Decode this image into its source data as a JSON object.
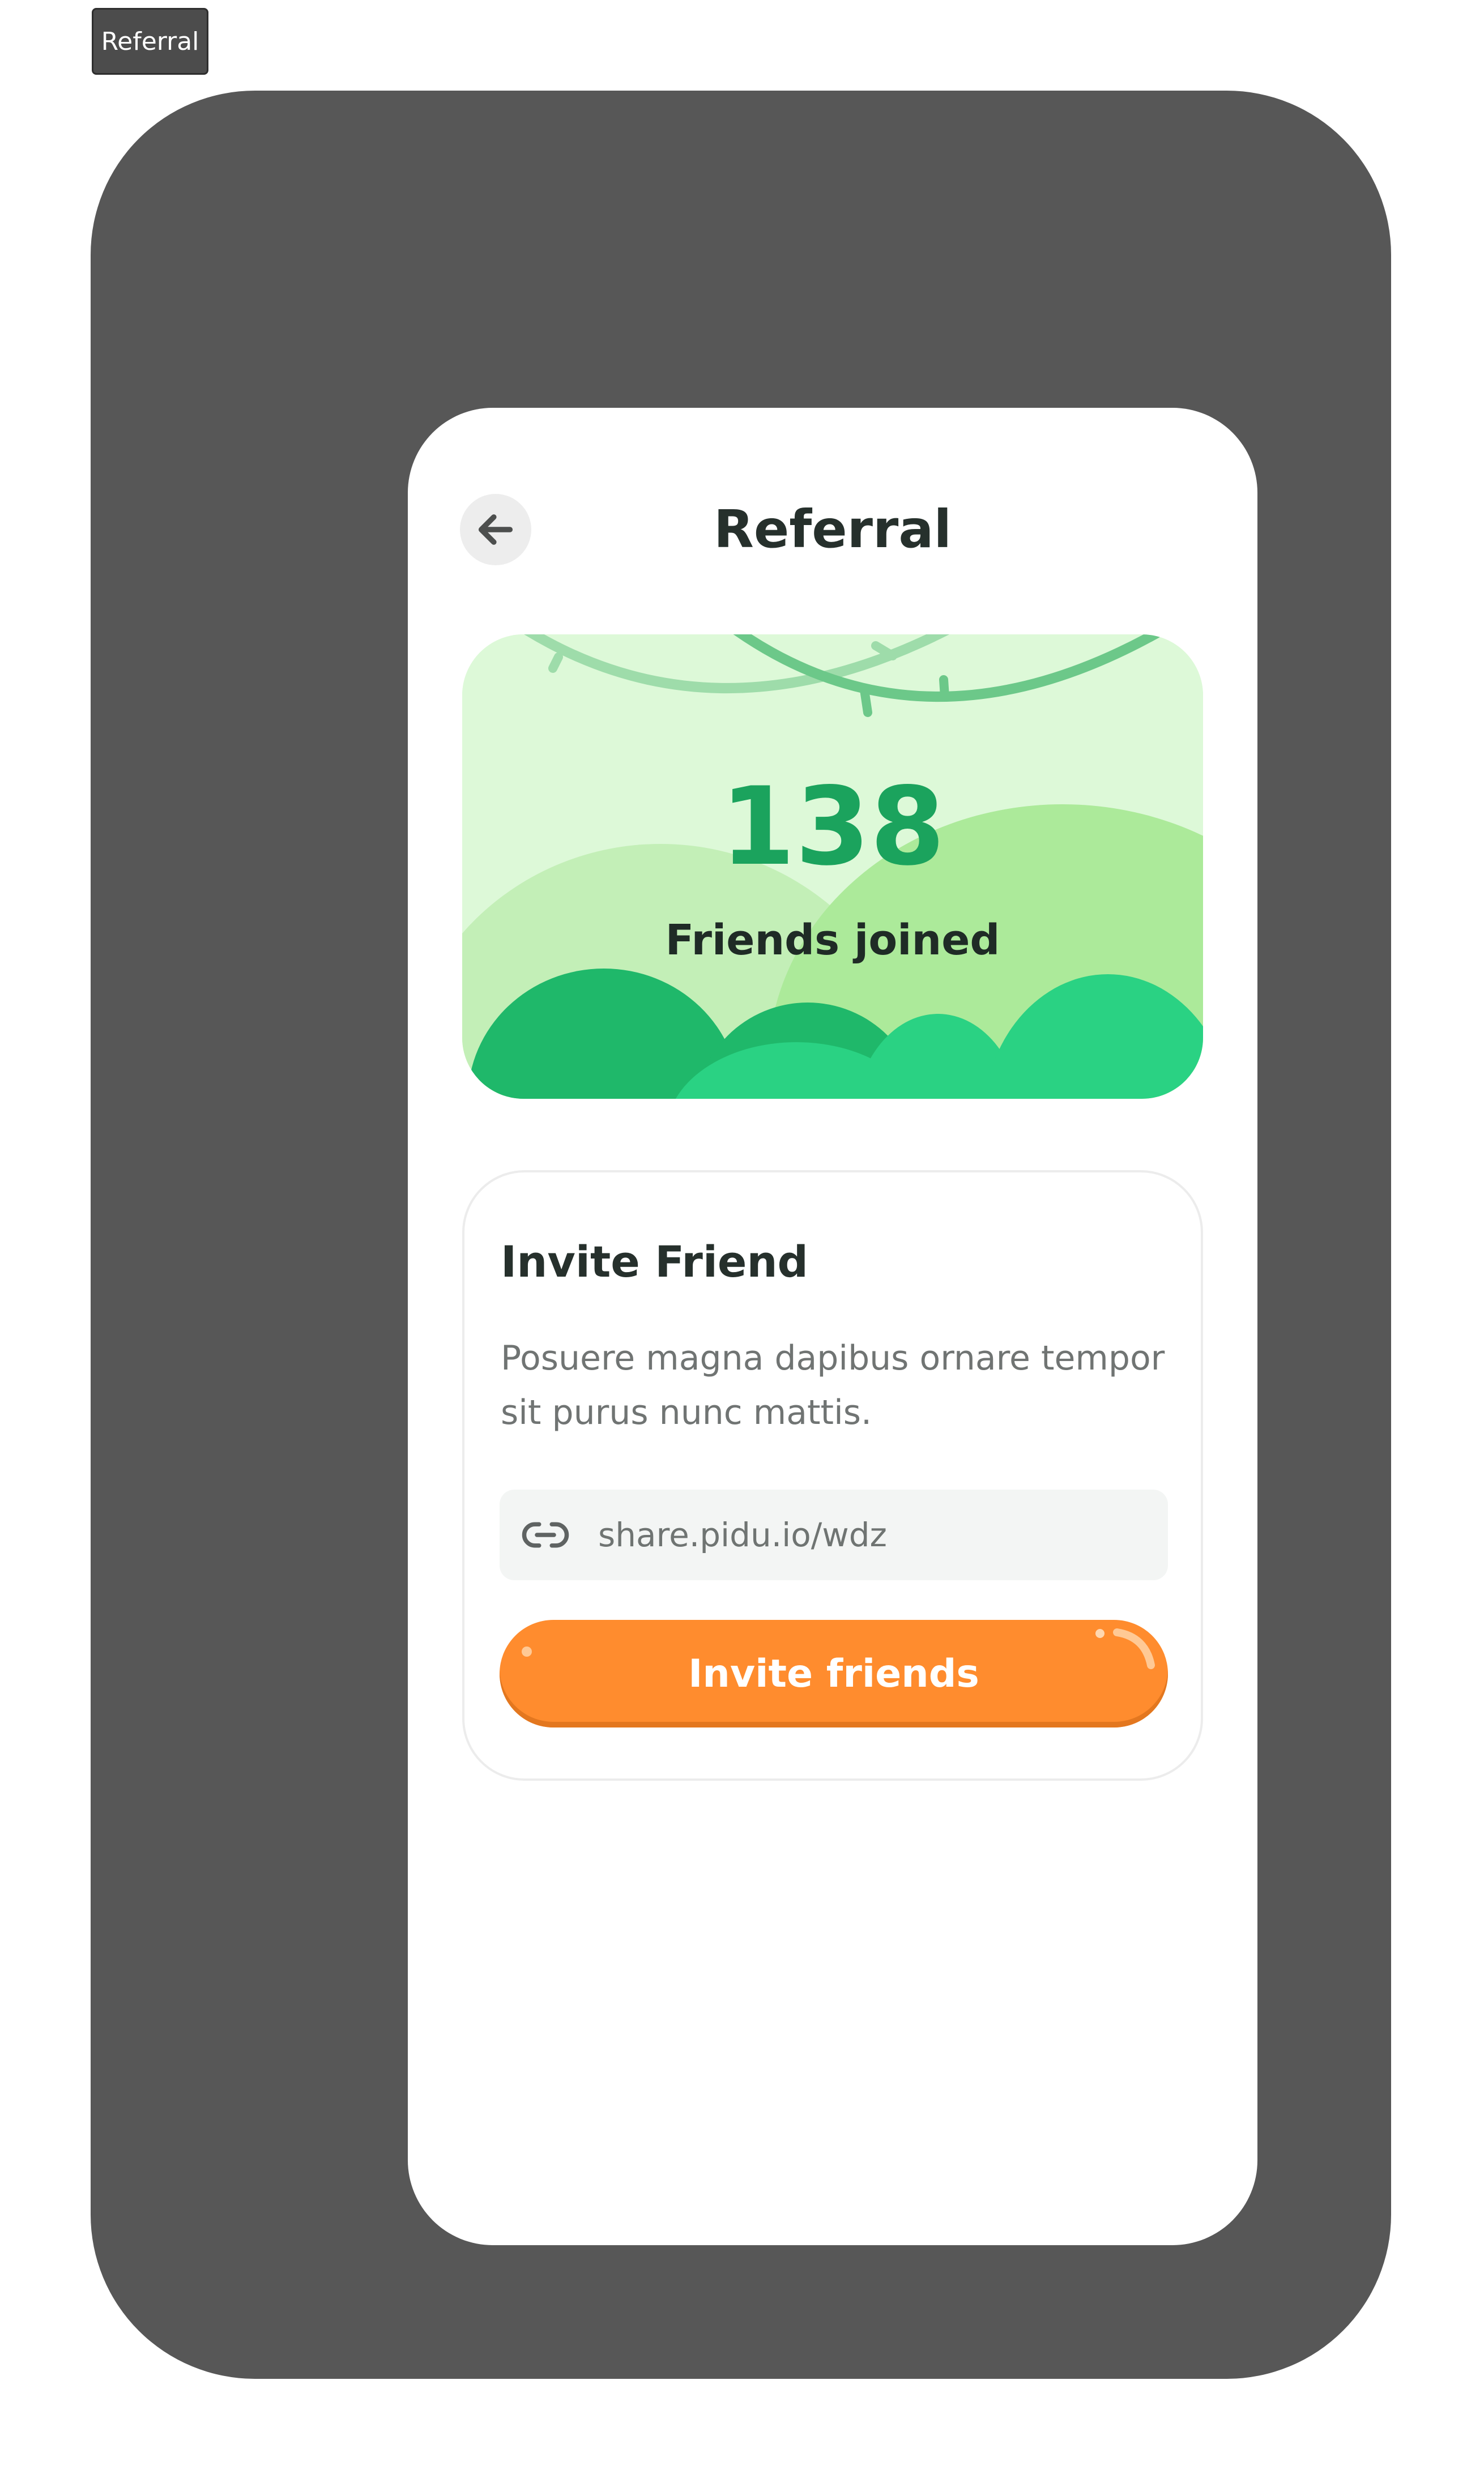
{
  "tag": {
    "label": "Referral"
  },
  "header": {
    "title": "Referral",
    "back_icon": "arrow-left-icon"
  },
  "hero": {
    "count": "138",
    "label": "Friends joined"
  },
  "invite_card": {
    "title": "Invite Friend",
    "description": "Posuere magna dapibus ornare tempor sit purus nunc mattis.",
    "link_icon": "link-icon",
    "link": "share.pidu.io/wdz",
    "button_label": "Invite friends"
  },
  "colors": {
    "accent_green": "#1ba35d",
    "button_orange": "#ff8c2e",
    "hero_bg": "#ddf9d8",
    "frame": "#575757"
  }
}
